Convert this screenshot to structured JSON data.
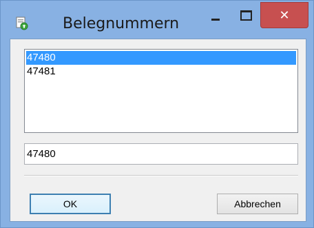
{
  "window": {
    "title": "Belegnummern",
    "controls": {
      "minimize_icon": "minimize-icon",
      "maximize_icon": "maximize-icon",
      "close_glyph": "✕"
    },
    "app_icon": "app-icon"
  },
  "list": {
    "items": [
      {
        "label": "47480",
        "selected": true
      },
      {
        "label": "47481",
        "selected": false
      }
    ]
  },
  "input": {
    "value": "47480"
  },
  "buttons": {
    "ok_label": "OK",
    "cancel_label": "Abbrechen"
  },
  "colors": {
    "titlebar": "#88b1e3",
    "close_button": "#c75050",
    "selection": "#3399ff",
    "client_bg": "#f0f0f0"
  }
}
